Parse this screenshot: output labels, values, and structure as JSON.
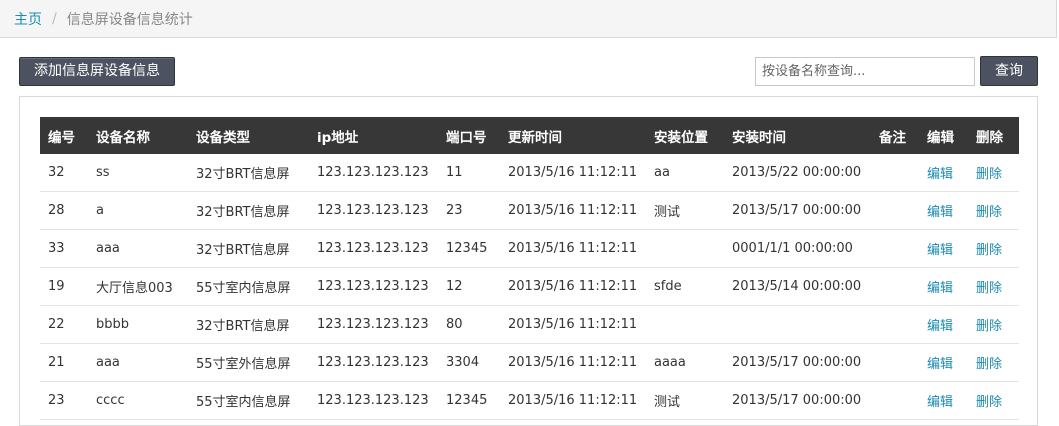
{
  "breadcrumb": {
    "home": "主页",
    "separator": "/",
    "current": "信息屏设备信息统计"
  },
  "toolbar": {
    "add_label": "添加信息屏设备信息",
    "search_placeholder": "按设备名称查询...",
    "search_value": "",
    "search_label": "查询"
  },
  "table": {
    "headers": [
      "编号",
      "设备名称",
      "设备类型",
      "ip地址",
      "端口号",
      "更新时间",
      "安装位置",
      "安装时间",
      "备注",
      "编辑",
      "删除"
    ],
    "rows": [
      {
        "id": "32",
        "name": "ss",
        "type": "32寸BRT信息屏",
        "ip": "123.123.123.123",
        "port": "11",
        "updated": "2013/5/16 11:12:11",
        "location": "aa",
        "installed": "2013/5/22 00:00:00",
        "note": "",
        "edit": "编辑",
        "delete": "删除"
      },
      {
        "id": "28",
        "name": "a",
        "type": "32寸BRT信息屏",
        "ip": "123.123.123.123",
        "port": "23",
        "updated": "2013/5/16 11:12:11",
        "location": "测试",
        "installed": "2013/5/17 00:00:00",
        "note": "",
        "edit": "编辑",
        "delete": "删除"
      },
      {
        "id": "33",
        "name": "aaa",
        "type": "32寸BRT信息屏",
        "ip": "123.123.123.123",
        "port": "12345",
        "updated": "2013/5/16 11:12:11",
        "location": "",
        "installed": "0001/1/1 00:00:00",
        "note": "",
        "edit": "编辑",
        "delete": "删除"
      },
      {
        "id": "19",
        "name": "大厅信息003",
        "type": "55寸室内信息屏",
        "ip": "123.123.123.123",
        "port": "12",
        "updated": "2013/5/16 11:12:11",
        "location": "sfde",
        "installed": "2013/5/14 00:00:00",
        "note": "",
        "edit": "编辑",
        "delete": "删除"
      },
      {
        "id": "22",
        "name": "bbbb",
        "type": "32寸BRT信息屏",
        "ip": "123.123.123.123",
        "port": "80",
        "updated": "2013/5/16 11:12:11",
        "location": "",
        "installed": "",
        "note": "",
        "edit": "编辑",
        "delete": "删除"
      },
      {
        "id": "21",
        "name": "aaa",
        "type": "55寸室外信息屏",
        "ip": "123.123.123.123",
        "port": "3304",
        "updated": "2013/5/16 11:12:11",
        "location": "aaaa",
        "installed": "2013/5/17 00:00:00",
        "note": "",
        "edit": "编辑",
        "delete": "删除"
      },
      {
        "id": "23",
        "name": "cccc",
        "type": "55寸室内信息屏",
        "ip": "123.123.123.123",
        "port": "12345",
        "updated": "2013/5/16 11:12:11",
        "location": "测试",
        "installed": "2013/5/17 00:00:00",
        "note": "",
        "edit": "编辑",
        "delete": "删除"
      }
    ]
  }
}
